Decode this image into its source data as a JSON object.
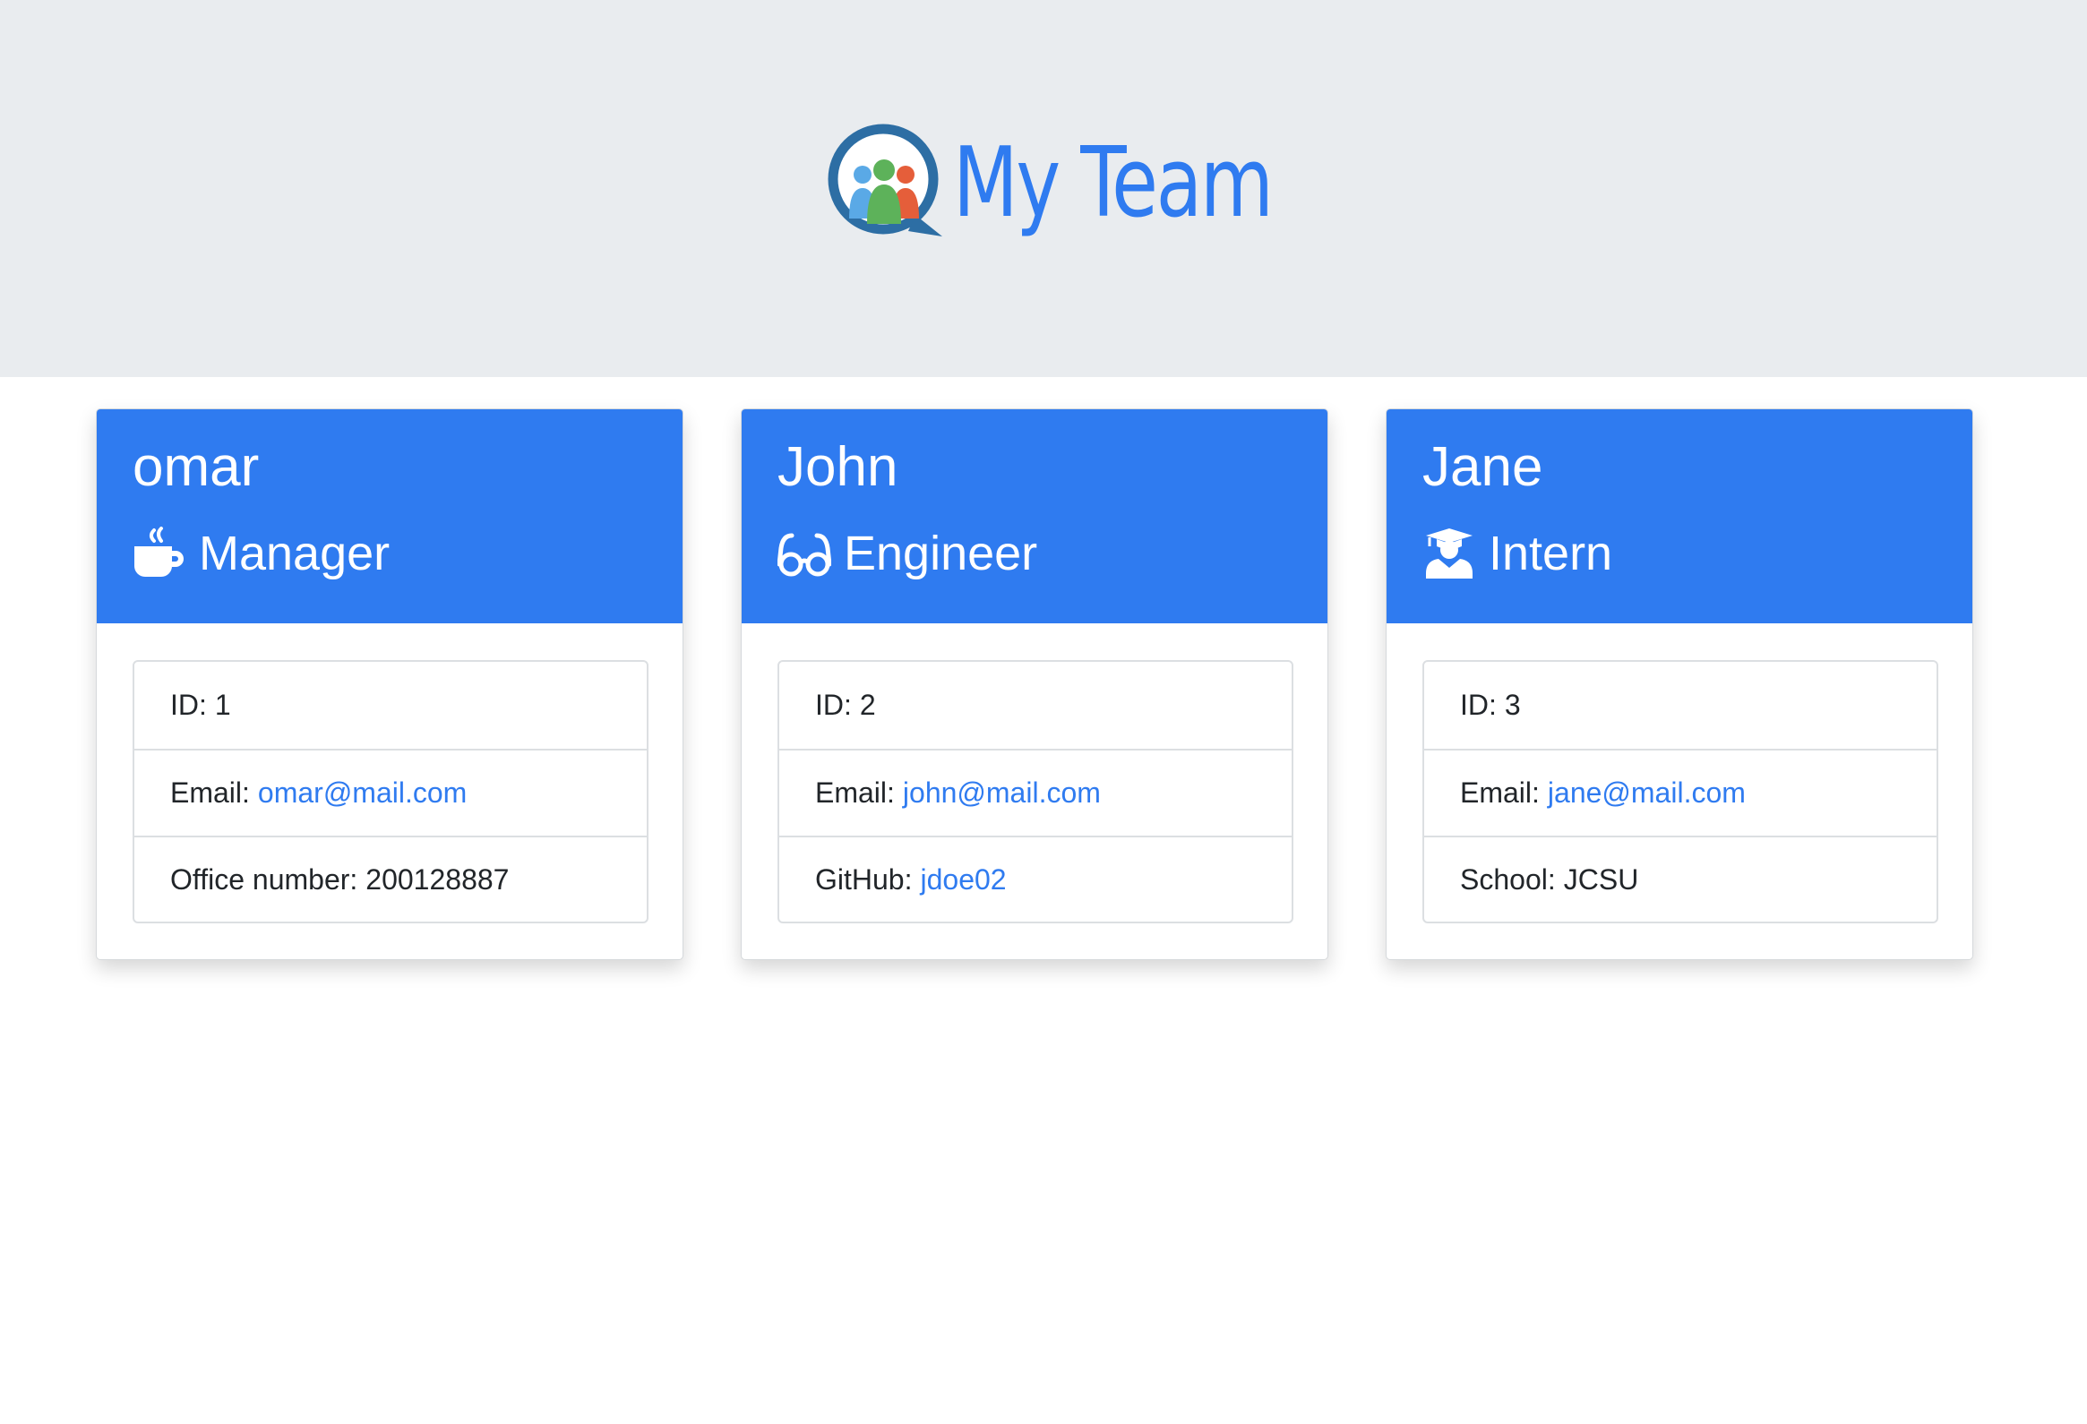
{
  "header": {
    "title": "My Team",
    "logo_icon": "team-chat-logo-icon"
  },
  "colors": {
    "accent": "#2f7bf0",
    "hero_background": "#e9ecef",
    "text": "#212529"
  },
  "cards": [
    {
      "name": "omar",
      "role": "Manager",
      "role_icon": "mug-hot-icon",
      "id_label": "ID:",
      "id": "1",
      "email_label": "Email:",
      "email": "omar@mail.com",
      "extra_label": "Office number:",
      "extra_value": "200128887"
    },
    {
      "name": "John",
      "role": "Engineer",
      "role_icon": "glasses-icon",
      "id_label": "ID:",
      "id": "2",
      "email_label": "Email:",
      "email": "john@mail.com",
      "extra_label": "GitHub:",
      "extra_value": "jdoe02"
    },
    {
      "name": "Jane",
      "role": "Intern",
      "role_icon": "graduate-icon",
      "id_label": "ID:",
      "id": "3",
      "email_label": "Email:",
      "email": "jane@mail.com",
      "extra_label": "School:",
      "extra_value": "JCSU"
    }
  ]
}
